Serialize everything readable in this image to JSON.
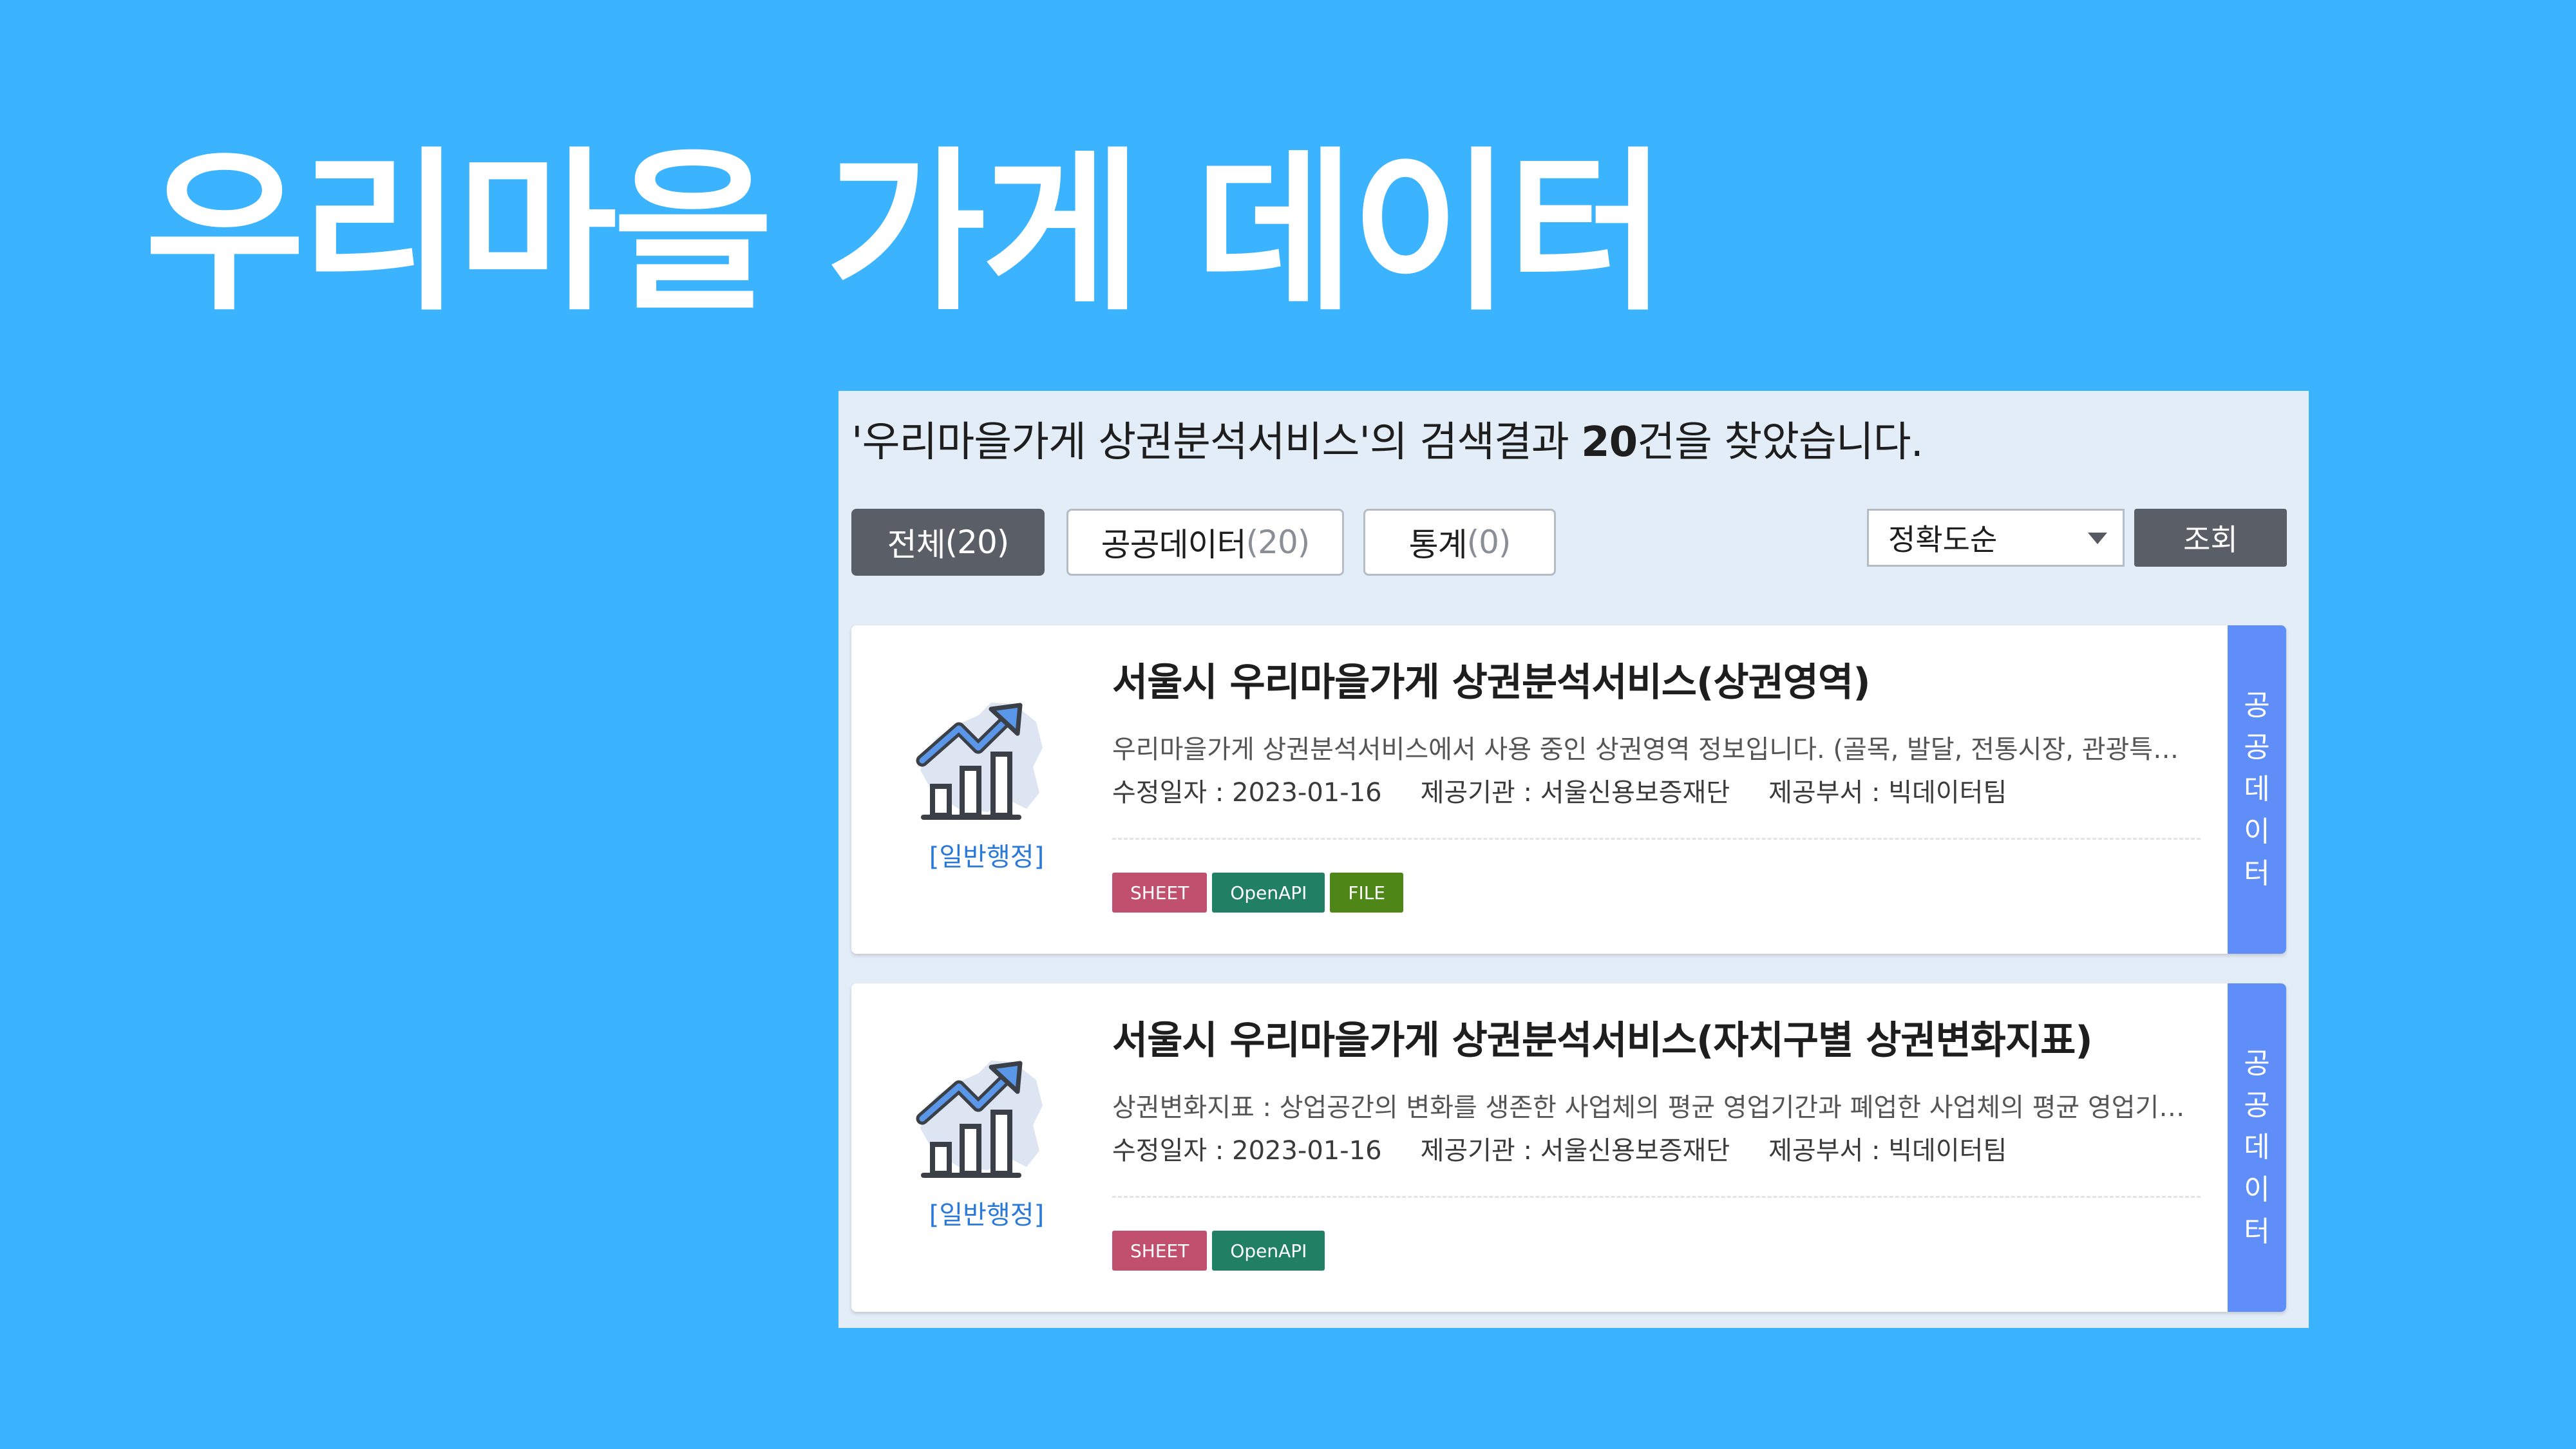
{
  "title": "우리마을 가게 데이터",
  "search": {
    "summary_prefix": "'우리마을가게 상권분석서비스'의 검색결과 ",
    "summary_count": "20",
    "summary_suffix": "건을 찾았습니다."
  },
  "tabs": [
    {
      "label": "전체",
      "count": "(20)"
    },
    {
      "label": "공공데이터",
      "count": "(20)"
    },
    {
      "label": "통계",
      "count": "(0)"
    }
  ],
  "sort": {
    "selected": "정확도순"
  },
  "search_button": "조회",
  "meta_labels": {
    "modified": "수정일자 :",
    "provider": "제공기관 :",
    "department": "제공부서 :"
  },
  "results": [
    {
      "title": "서울시 우리마을가게 상권분석서비스(상권영역)",
      "description": "우리마을가게 상권분석서비스에서 사용 중인 상권영역 정보입니다. (골목, 발달, 전통시장, 관광특구 ...",
      "modified": "2023-01-16",
      "provider": "서울신용보증재단",
      "department": "빅데이터팀",
      "category": "[일반행정]",
      "tags": [
        "SHEET",
        "OpenAPI",
        "FILE"
      ],
      "side_label": [
        "공",
        "공",
        "데",
        "이",
        "터"
      ]
    },
    {
      "title": "서울시 우리마을가게 상권분석서비스(자치구별 상권변화지표)",
      "description": "상권변화지표 : 상업공간의 변화를 생존한 사업체의 평균 영업기간과 폐업한 사업체의 평균 영업기간을 이용해 분석한 지표입니다.",
      "modified": "2023-01-16",
      "provider": "서울신용보증재단",
      "department": "빅데이터팀",
      "category": "[일반행정]",
      "tags": [
        "SHEET",
        "OpenAPI"
      ],
      "side_label": [
        "공",
        "공",
        "데",
        "이",
        "터"
      ]
    }
  ],
  "icons": {
    "thumbnail": "trend-chart-seoul-map-icon",
    "sort_caret": "caret-down-icon"
  },
  "colors": {
    "background": "#3bb3fe",
    "panel": "#e3edf8",
    "active_tab": "#5a5e66",
    "tag_sheet": "#c0506e",
    "tag_openapi": "#218063",
    "tag_file": "#4e8617",
    "side_label": "#5f8ef8",
    "category": "#2a78d8"
  }
}
